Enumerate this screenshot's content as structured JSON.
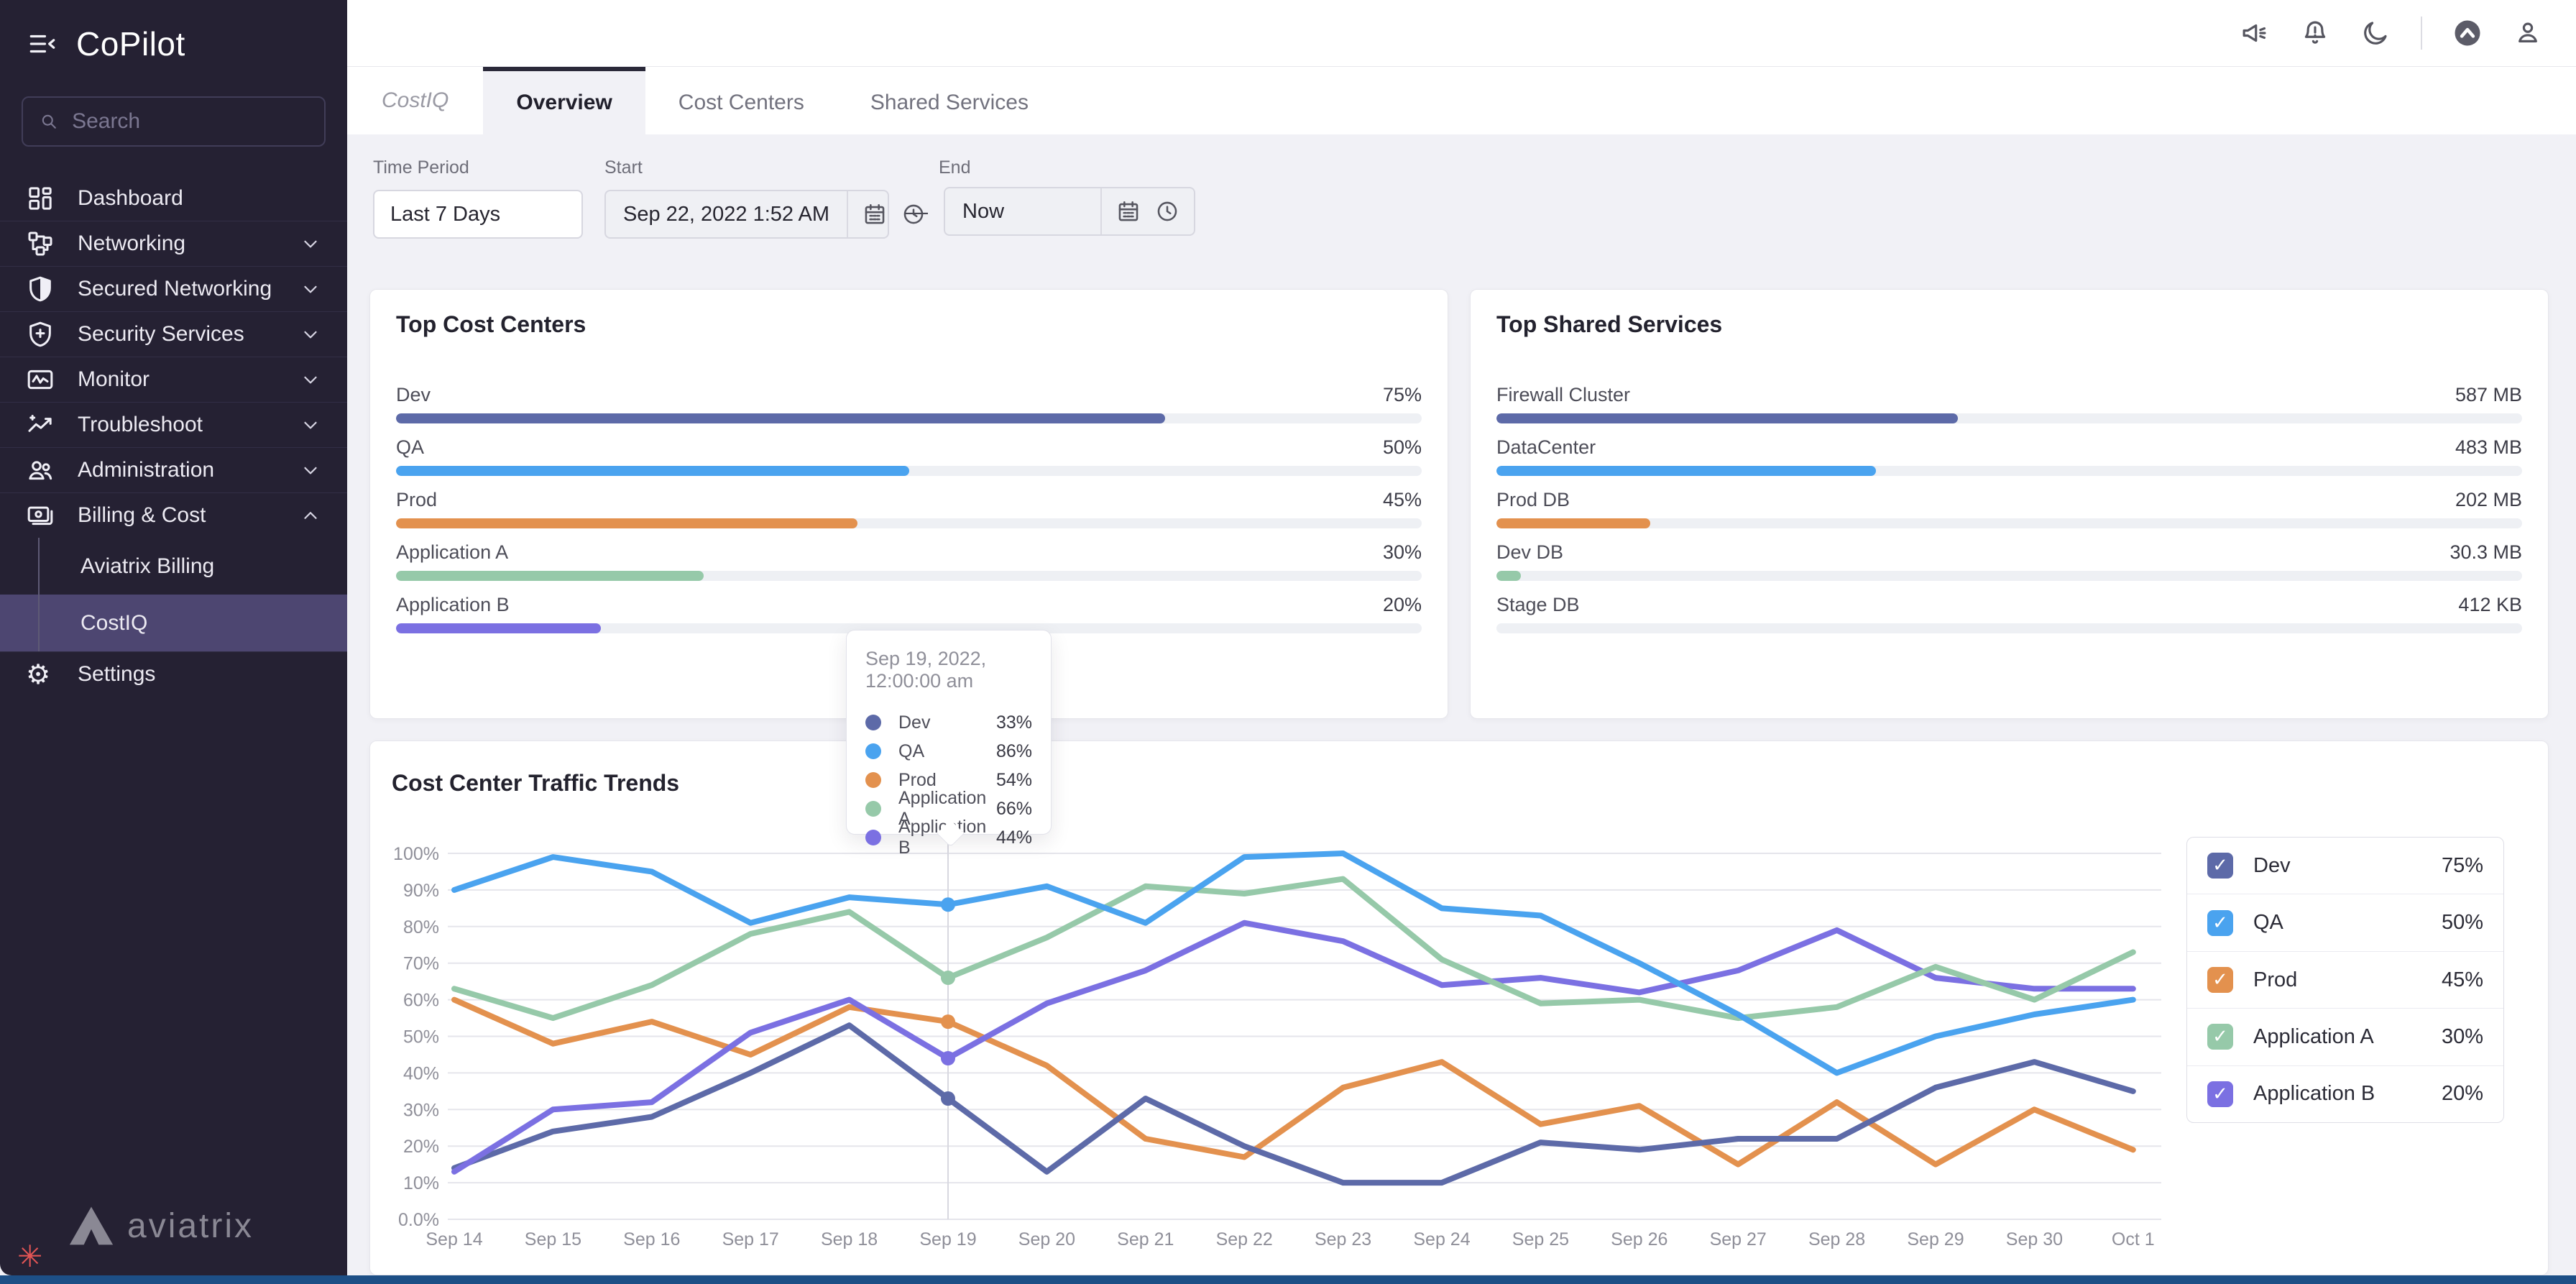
{
  "app": {
    "title": "CoPilot"
  },
  "colors": {
    "dev": "#5d6aa8",
    "qa": "#4aa3ef",
    "prod": "#e3914e",
    "app_a": "#96c9a9",
    "app_b": "#7b70e2"
  },
  "sidebar": {
    "search_placeholder": "Search",
    "logo_text": "aviatrix",
    "items": [
      {
        "label": "Dashboard",
        "icon": "dashboard"
      },
      {
        "label": "Networking",
        "icon": "networking",
        "chevron": "down"
      },
      {
        "label": "Secured Networking",
        "icon": "shield-half",
        "chevron": "down"
      },
      {
        "label": "Security Services",
        "icon": "shield-plus",
        "chevron": "down"
      },
      {
        "label": "Monitor",
        "icon": "monitor",
        "chevron": "down"
      },
      {
        "label": "Troubleshoot",
        "icon": "trend",
        "chevron": "down"
      },
      {
        "label": "Administration",
        "icon": "users",
        "chevron": "down"
      },
      {
        "label": "Billing & Cost",
        "icon": "billing",
        "chevron": "up"
      },
      {
        "label": "Aviatrix Billing",
        "child": true
      },
      {
        "label": "CostIQ",
        "child": true,
        "selected": true
      },
      {
        "label": "Settings",
        "icon": "gear"
      }
    ]
  },
  "topbar": {
    "icons": [
      {
        "icon": "megaphone",
        "name": "announcements-megaphone-icon"
      },
      {
        "icon": "bell",
        "name": "notifications-bell-icon"
      },
      {
        "icon": "moon",
        "name": "dark-mode-moon-icon"
      },
      {
        "divider": true
      },
      {
        "icon": "avatar",
        "name": "aviatrix-avatar-icon"
      },
      {
        "icon": "user",
        "name": "user-profile-icon"
      }
    ]
  },
  "tabbar": {
    "module_label": "CostIQ",
    "tabs": [
      {
        "label": "Overview",
        "active": true
      },
      {
        "label": "Cost Centers"
      },
      {
        "label": "Shared Services"
      }
    ]
  },
  "filters": {
    "time_period": {
      "label": "Time Period",
      "value": "Last 7 Days",
      "icon": "chevron-down"
    },
    "start": {
      "label": "Start",
      "value": "Sep 22, 2022 1:52 AM",
      "icons": [
        "calendar",
        "clock"
      ]
    },
    "end": {
      "label": "End",
      "value": "Now",
      "icons": [
        "calendar",
        "clock"
      ]
    },
    "separator": "—"
  },
  "cards": [
    {
      "title": "Top Cost Centers",
      "rows": [
        {
          "label": "Dev",
          "value": "75%",
          "pct": 75,
          "color": "dev"
        },
        {
          "label": "QA",
          "value": "50%",
          "pct": 50,
          "color": "qa"
        },
        {
          "label": "Prod",
          "value": "45%",
          "pct": 45,
          "color": "prod"
        },
        {
          "label": "Application A",
          "value": "30%",
          "pct": 30,
          "color": "app_a"
        },
        {
          "label": "Application B",
          "value": "20%",
          "pct": 20,
          "color": "app_b"
        }
      ]
    },
    {
      "title": "Top Shared Services",
      "rows": [
        {
          "label": "Firewall Cluster",
          "value": "587 MB",
          "pct": 45,
          "color": "dev"
        },
        {
          "label": "DataCenter",
          "value": "483 MB",
          "pct": 37,
          "color": "qa"
        },
        {
          "label": "Prod DB",
          "value": "202 MB",
          "pct": 15,
          "color": "prod"
        },
        {
          "label": "Dev DB",
          "value": "30.3 MB",
          "pct": 2.4,
          "color": "app_a"
        },
        {
          "label": "Stage DB",
          "value": "412 KB",
          "pct": 0,
          "color": "app_b"
        }
      ]
    }
  ],
  "tooltip": {
    "title": "Sep 19, 2022, 12:00:00 am",
    "rows": [
      {
        "color": "dev",
        "label": "Dev",
        "value": "33%"
      },
      {
        "color": "qa",
        "label": "QA",
        "value": "86%"
      },
      {
        "color": "prod",
        "label": "Prod",
        "value": "54%"
      },
      {
        "color": "app_a",
        "label": "Application A",
        "value": "66%"
      },
      {
        "color": "app_b",
        "label": "Application B",
        "value": "44%"
      }
    ]
  },
  "legend": [
    {
      "color": "dev",
      "label": "Dev",
      "value": "75%"
    },
    {
      "color": "qa",
      "label": "QA",
      "value": "50%"
    },
    {
      "color": "prod",
      "label": "Prod",
      "value": "45%"
    },
    {
      "color": "app_a",
      "label": "Application A",
      "value": "30%"
    },
    {
      "color": "app_b",
      "label": "Application B",
      "value": "20%"
    }
  ],
  "chart_data": {
    "type": "line",
    "title": "Cost Center Traffic Trends",
    "x": [
      "Sep 14",
      "Sep 15",
      "Sep 16",
      "Sep 17",
      "Sep 18",
      "Sep 19",
      "Sep 20",
      "Sep 21",
      "Sep 22",
      "Sep 23",
      "Sep 24",
      "Sep 25",
      "Sep 26",
      "Sep 27",
      "Sep 28",
      "Sep 29",
      "Sep 30",
      "Oct 1"
    ],
    "y_tick_labels": [
      "0.0%",
      "10%",
      "20%",
      "30%",
      "40%",
      "50%",
      "60%",
      "70%",
      "80%",
      "90%",
      "100%"
    ],
    "ylim": [
      0,
      100
    ],
    "grid": "horizontal",
    "legend_position": "right",
    "hover_index": 5,
    "hover_label": "Sep 19, 2022, 12:00:00 am",
    "series": [
      {
        "key": "dev",
        "name": "Dev",
        "values": [
          14,
          24,
          28,
          40,
          53,
          33,
          13,
          33,
          20,
          10,
          10,
          21,
          19,
          22,
          22,
          36,
          43,
          35
        ]
      },
      {
        "key": "qa",
        "name": "QA",
        "values": [
          90,
          99,
          95,
          81,
          88,
          86,
          91,
          81,
          99,
          100,
          85,
          83,
          70,
          56,
          40,
          50,
          56,
          60
        ]
      },
      {
        "key": "prod",
        "name": "Prod",
        "values": [
          60,
          48,
          54,
          45,
          58,
          54,
          42,
          22,
          17,
          36,
          43,
          26,
          31,
          15,
          32,
          15,
          30,
          19
        ]
      },
      {
        "key": "app_a",
        "name": "Application A",
        "values": [
          63,
          55,
          64,
          78,
          84,
          66,
          77,
          91,
          89,
          93,
          71,
          59,
          60,
          55,
          58,
          69,
          60,
          73
        ]
      },
      {
        "key": "app_b",
        "name": "Application B",
        "values": [
          13,
          30,
          32,
          51,
          60,
          44,
          59,
          68,
          81,
          76,
          64,
          66,
          62,
          68,
          79,
          66,
          63,
          63
        ]
      }
    ]
  }
}
